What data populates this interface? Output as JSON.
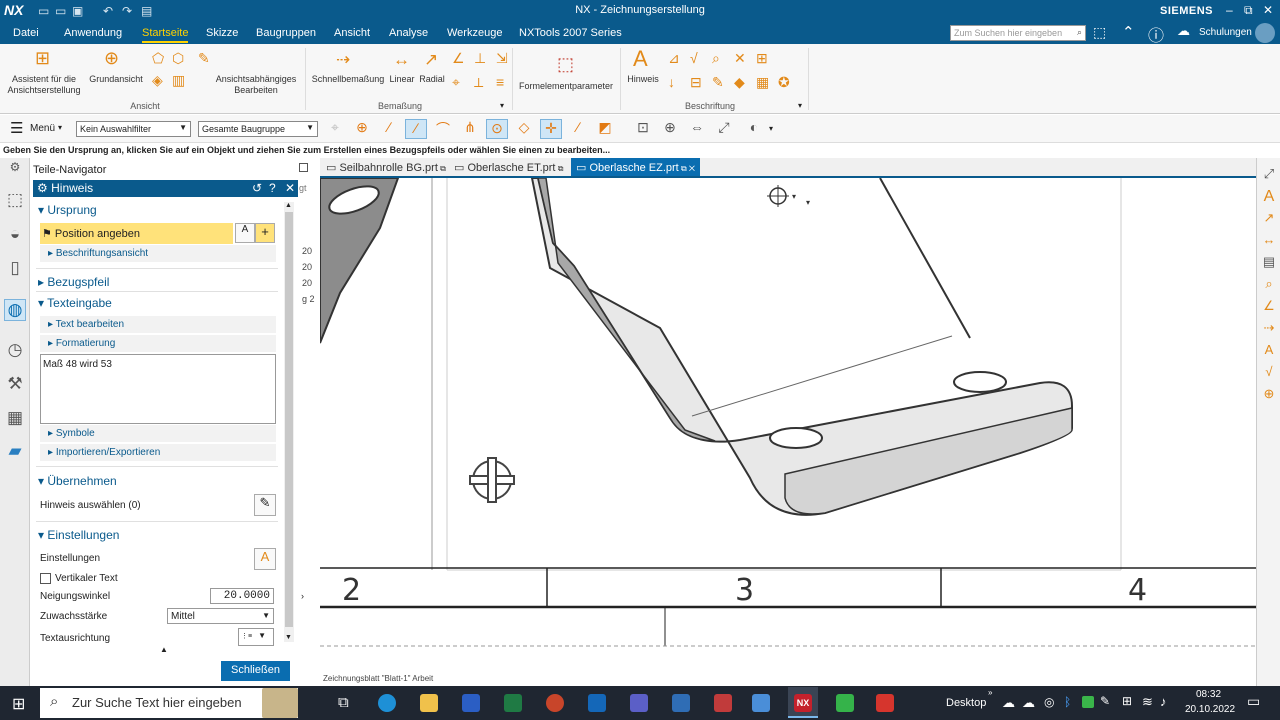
{
  "app": {
    "logo": "NX",
    "title": "NX - Zeichnungserstellung",
    "brand": "SIEMENS"
  },
  "menu": [
    "Datei",
    "Anwendung",
    "Startseite",
    "Skizze",
    "Baugruppen",
    "Ansicht",
    "Analyse",
    "Werkzeuge",
    "NXTools 2007 Series"
  ],
  "menu_active": "Startseite",
  "search": {
    "placeholder": "Zum Suchen hier eingeben",
    "user": "Schulungen"
  },
  "ribbon": {
    "ansicht": {
      "group": "Ansicht",
      "assistent": "Assistent für die Ansichtserstellung",
      "grundansicht": "Grundansicht",
      "ansichtsabh": "Ansichtsabhängiges Bearbeiten"
    },
    "bemassung": {
      "group": "Bemaßung",
      "schnell": "Schnellbemaßung",
      "linear": "Linear",
      "radial": "Radial"
    },
    "formelement": "Formelementparameter",
    "beschriftung": {
      "group": "Beschriftung",
      "hinweis": "Hinweis"
    }
  },
  "toolbar": {
    "menu": "Menü",
    "filter": "Kein Auswahlfilter",
    "scope": "Gesamte Baugruppe"
  },
  "status": "Geben Sie den Ursprung an, klicken Sie auf ein Objekt und ziehen Sie zum Erstellen eines Bezugspfeils oder wählen Sie einen zu bearbeiten...",
  "navigator": {
    "title": "Teile-Navigator",
    "peek": [
      "gt",
      "20",
      "20",
      "20",
      "g 2"
    ]
  },
  "dialog": {
    "title": "Hinweis",
    "ursprung": "Ursprung",
    "position": "Position angeben",
    "beschriftungsansicht": "Beschriftungsansicht",
    "bezugspfeil": "Bezugspfeil",
    "texteingabe": "Texteingabe",
    "text_bearbeiten": "Text bearbeiten",
    "formatierung": "Formatierung",
    "text": "Maß 48 wird 53",
    "symbole": "Symbole",
    "import": "Importieren/Exportieren",
    "uebernehmen": "Übernehmen",
    "hinweis_auswaehlen": "Hinweis auswählen (0)",
    "einstellungen": "Einstellungen",
    "einstellungen_lbl": "Einstellungen",
    "vertikal": "Vertikaler Text",
    "neigungswinkel": "Neigungswinkel",
    "neigungswinkel_val": "20.0000",
    "zuwachs": "Zuwachsstärke",
    "zuwachs_val": "Mittel",
    "ausrichtung": "Textausrichtung",
    "close": "Schließen"
  },
  "tabs": [
    {
      "label": "Seilbahnrolle BG.prt"
    },
    {
      "label": "Oberlasche ET.prt"
    },
    {
      "label": "Oberlasche EZ.prt",
      "active": true
    }
  ],
  "zones": [
    "2",
    "3",
    "4"
  ],
  "sheet_label": "Zeichnungsblatt \"Blatt-1\" Arbeit",
  "taskbar": {
    "search": "Zur Suche Text hier eingeben",
    "desktop": "Desktop",
    "time": "08:32",
    "date": "20.10.2022"
  }
}
